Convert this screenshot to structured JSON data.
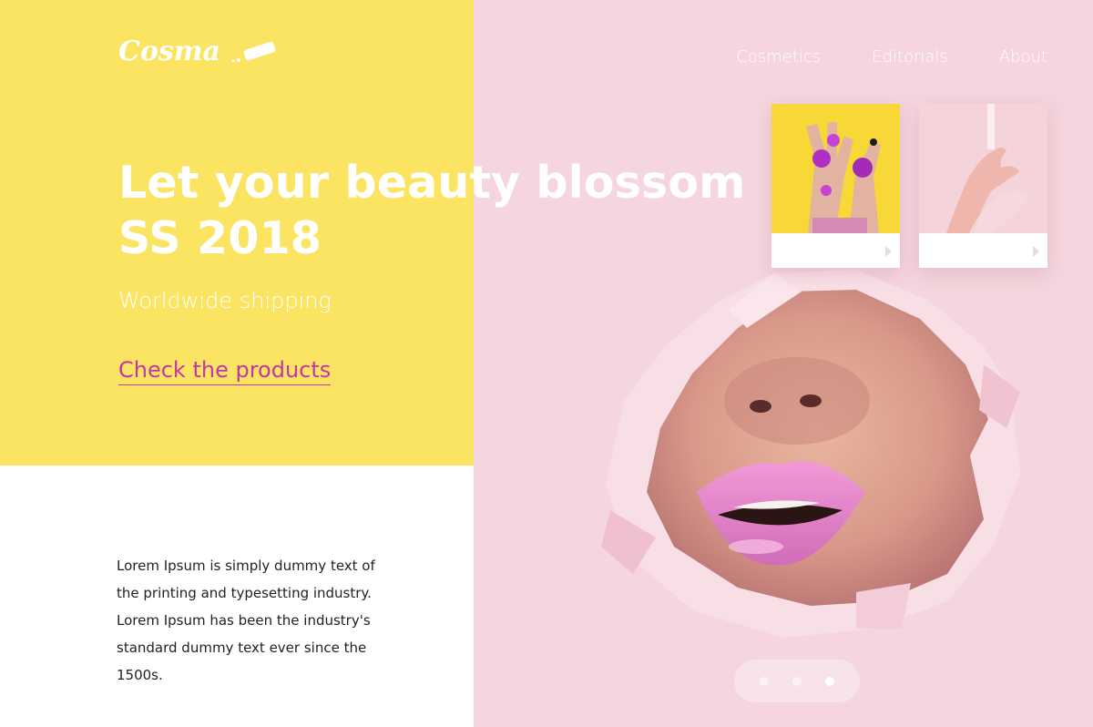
{
  "brand": {
    "logo_text": "Cosma"
  },
  "nav": {
    "items": [
      "Cosmetics",
      "Editorials",
      "About"
    ]
  },
  "hero": {
    "headline_line1": "Let your beauty blossom",
    "headline_line2": "SS 2018",
    "subline": "Worldwide shipping",
    "cta_label": "Check the products"
  },
  "intro": {
    "text": "Lorem Ipsum is simply dummy text of the printing and typesetting industry. Lorem Ipsum has been the industry's standard dummy text ever since the 1500s."
  },
  "cards": [
    {
      "icon": "chevron-right-icon"
    },
    {
      "icon": "chevron-right-icon"
    }
  ],
  "slider": {
    "count": 3,
    "active_index": 2
  },
  "colors": {
    "yellow": "#fbe462",
    "pink_background": "#f5d5de",
    "accent_magenta": "#c237a8",
    "text_dark": "#222222"
  }
}
